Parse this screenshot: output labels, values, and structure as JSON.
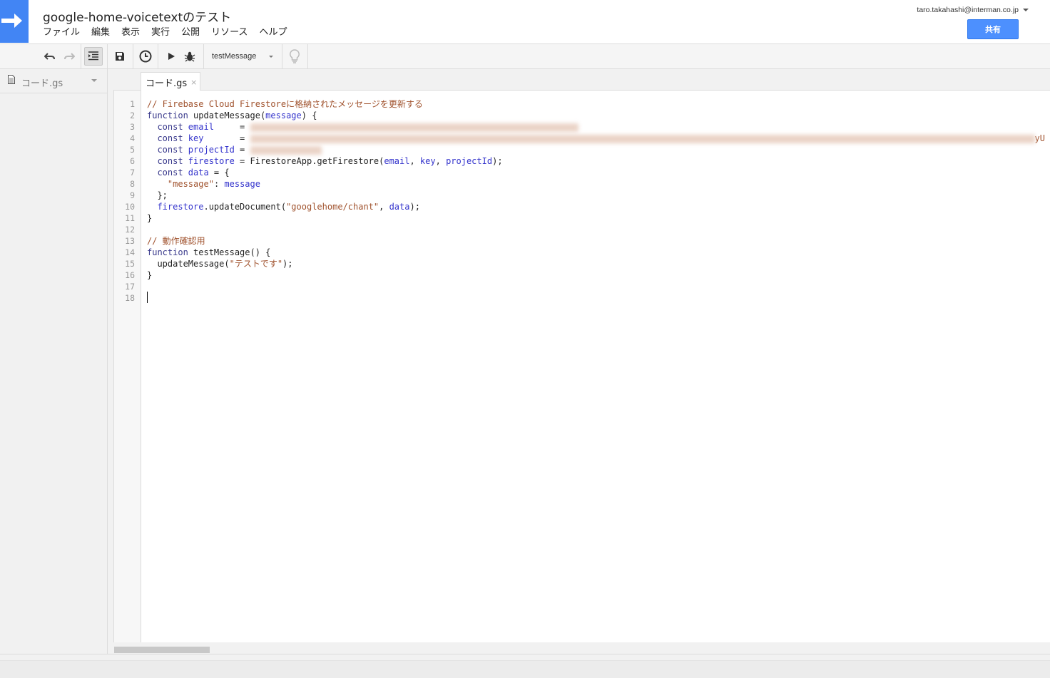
{
  "header": {
    "title": "google-home-voicetextのテスト",
    "menu": [
      "ファイル",
      "編集",
      "表示",
      "実行",
      "公開",
      "リソース",
      "ヘルプ"
    ],
    "account": "taro.takahashi@interman.co.jp",
    "share_label": "共有"
  },
  "toolbar": {
    "function_select": "testMessage",
    "icons": [
      "undo-icon",
      "redo-icon",
      "indent-icon",
      "save-icon",
      "triggers-icon",
      "run-icon",
      "debug-icon",
      "lightbulb-icon"
    ]
  },
  "sidebar": {
    "files": [
      {
        "name": "コード.gs"
      }
    ]
  },
  "editor": {
    "tab_label": "コード.gs",
    "tab_close": "×",
    "line_numbers": [
      "1",
      "2",
      "3",
      "4",
      "5",
      "6",
      "7",
      "8",
      "9",
      "10",
      "11",
      "12",
      "13",
      "14",
      "15",
      "16",
      "17",
      "18"
    ],
    "lines": [
      [
        {
          "t": "// Firebase Cloud Firestoreに格納されたメッセージを更新する",
          "c": "comment"
        }
      ],
      [
        {
          "t": "function",
          "c": "kw"
        },
        {
          "t": " updateMessage(",
          "c": "plain"
        },
        {
          "t": "message",
          "c": "var"
        },
        {
          "t": ") {",
          "c": "plain"
        }
      ],
      [
        {
          "t": "  const ",
          "c": "kw"
        },
        {
          "t": "email",
          "c": "var"
        },
        {
          "t": "     = ",
          "c": "plain"
        },
        {
          "t": "BLUR",
          "c": "blur",
          "w": 460
        }
      ],
      [
        {
          "t": "  const ",
          "c": "kw"
        },
        {
          "t": "key",
          "c": "var"
        },
        {
          "t": "       = ",
          "c": "plain"
        },
        {
          "t": "BLUR",
          "c": "blur",
          "w": 1100
        },
        {
          "t": "yU",
          "c": "str"
        }
      ],
      [
        {
          "t": "  const ",
          "c": "kw"
        },
        {
          "t": "projectId",
          "c": "var"
        },
        {
          "t": " = ",
          "c": "plain"
        },
        {
          "t": "BLUR",
          "c": "blur",
          "w": 100
        }
      ],
      [
        {
          "t": "  const ",
          "c": "kw"
        },
        {
          "t": "firestore",
          "c": "var"
        },
        {
          "t": " = FirestoreApp.getFirestore(",
          "c": "plain"
        },
        {
          "t": "email",
          "c": "var"
        },
        {
          "t": ", ",
          "c": "plain"
        },
        {
          "t": "key",
          "c": "var"
        },
        {
          "t": ", ",
          "c": "plain"
        },
        {
          "t": "projectId",
          "c": "var"
        },
        {
          "t": ");",
          "c": "plain"
        }
      ],
      [
        {
          "t": "  const ",
          "c": "kw"
        },
        {
          "t": "data",
          "c": "var"
        },
        {
          "t": " = {",
          "c": "plain"
        }
      ],
      [
        {
          "t": "    ",
          "c": "plain"
        },
        {
          "t": "\"message\"",
          "c": "str"
        },
        {
          "t": ": ",
          "c": "plain"
        },
        {
          "t": "message",
          "c": "var"
        }
      ],
      [
        {
          "t": "  };",
          "c": "plain"
        }
      ],
      [
        {
          "t": "  ",
          "c": "plain"
        },
        {
          "t": "firestore",
          "c": "var"
        },
        {
          "t": ".updateDocument(",
          "c": "plain"
        },
        {
          "t": "\"googlehome/chant\"",
          "c": "str"
        },
        {
          "t": ", ",
          "c": "plain"
        },
        {
          "t": "data",
          "c": "var"
        },
        {
          "t": ");",
          "c": "plain"
        }
      ],
      [
        {
          "t": "}",
          "c": "plain"
        }
      ],
      [],
      [
        {
          "t": "// 動作確認用",
          "c": "comment"
        }
      ],
      [
        {
          "t": "function",
          "c": "kw"
        },
        {
          "t": " testMessage() {",
          "c": "plain"
        }
      ],
      [
        {
          "t": "  updateMessage(",
          "c": "plain"
        },
        {
          "t": "\"テストです\"",
          "c": "str"
        },
        {
          "t": ");",
          "c": "plain"
        }
      ],
      [
        {
          "t": "}",
          "c": "plain"
        }
      ],
      [],
      []
    ]
  },
  "colors": {
    "brand_blue": "#4285f4",
    "share_blue": "#4d90fe",
    "comment": "#a0522d",
    "keyword": "#3a3a8c",
    "variable": "#3333cc"
  }
}
